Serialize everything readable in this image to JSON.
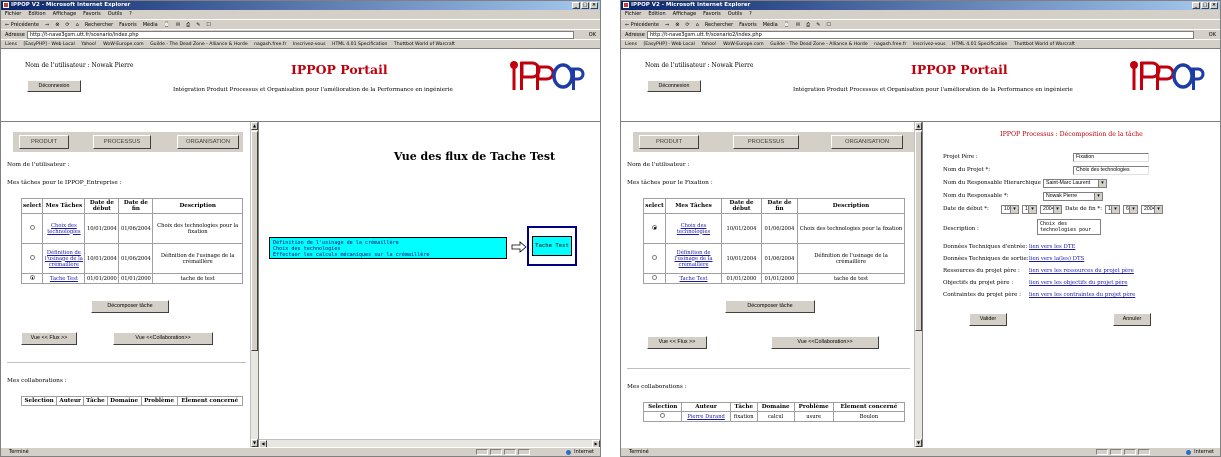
{
  "browser": {
    "window_title": "IPPOP V2 - Microsoft Internet Explorer",
    "menu": [
      "Fichier",
      "Edition",
      "Affichage",
      "Favoris",
      "Outils",
      "?"
    ],
    "toolbar": [
      "⇐ Précédente",
      "⇒",
      "⊗",
      "⟳",
      "⌂",
      "Rechercher",
      "Favoris",
      "Média",
      "⌚",
      "✉",
      "⎙",
      "✎",
      "☐"
    ],
    "address_label": "Adresse",
    "address_left": "http://t-nave3gsm.utt.fr/scenario/index.php",
    "address_right": "http://t-nave3gsm.utt.fr/scenario2/index.php",
    "go_label": "OK",
    "links_label": "Liens",
    "links": [
      "[EasyPHP] - Web Local",
      "Yahoo!",
      "WoW-Europe.com",
      "Guilde - The Dead Zone - Alliance & Horde",
      "nagash.free.fr",
      "Inscrivez-vous",
      "HTML 4.01 Specification",
      "Thottbot World of Warcraft"
    ],
    "status_text": "Terminé",
    "zone_text": "Internet"
  },
  "header": {
    "user_label_left": "Nom de l'utilisateur : Nowak Pierre",
    "user_label_right": "Nom de l'utilisateur : Nowak Pierre",
    "logout": "Déconnexion",
    "portal_title": "IPPOP Portail",
    "subtitle": "Intégration Produit Processus et Organisation pour l'amélioration de la Performance en ingénierie"
  },
  "tabs": [
    "PRODUIT",
    "PROCESSUS",
    "ORGANISATION"
  ],
  "left_panel": {
    "user_name_label": "Nom de l'utilisateur :",
    "tasks_title_left": "Mes tâches pour le IPPOP_Entreprise :",
    "tasks_title_right": "Mes tâches pour le Fixation :",
    "columns": [
      "select",
      "Mes Tâches",
      "Date de début",
      "Date de fin",
      "Description"
    ],
    "rows_left": [
      {
        "task": "Choix des technologies",
        "start": "10/01/2004",
        "end": "01/06/2004",
        "desc": "Choix des technologies pour la fixation",
        "selected": false
      },
      {
        "task": "Définition de l'usinage de la crémaillère",
        "start": "10/01/2004",
        "end": "01/06/2004",
        "desc": "Définition de l'usinage de la crémaillère",
        "selected": false
      },
      {
        "task": "Tache Test",
        "start": "01/01/2000",
        "end": "01/01/2000",
        "desc": "tache de test",
        "selected": true
      }
    ],
    "rows_right": [
      {
        "task": "Choix des technologies",
        "start": "10/01/2004",
        "end": "01/06/2004",
        "desc": "Choix des technologies pour la fixation",
        "selected": true
      },
      {
        "task": "Définition de l'usinage de la crémaillère",
        "start": "10/01/2004",
        "end": "01/06/2004",
        "desc": "Définition de l'usinage de la crémaillère",
        "selected": false
      },
      {
        "task": "Tache Test",
        "start": "01/01/2000",
        "end": "01/01/2000",
        "desc": "tache de test",
        "selected": false
      }
    ],
    "decompose": "Décomposer tâche",
    "view_flux": "Vue << Flux >>",
    "view_collab": "Vue <<Collaboration>>",
    "collab_title": "Mes collaborations :",
    "collab_columns": [
      "Selection",
      "Auteur",
      "Tâche",
      "Domaine",
      "Problème",
      "Element concerné"
    ],
    "collab_partial_row": [
      "",
      "Pierre Durand",
      "fixation",
      "calcul",
      "usure",
      "Boulon"
    ]
  },
  "flux_view": {
    "title": "Vue des flux de Tache Test",
    "inputs": [
      "Définition de l'usinage de la crémaillère",
      "Choix des technologies",
      "Effectuer les calculs mécaniques sur la crémaillère"
    ],
    "task": "Tache Test"
  },
  "decomp_form": {
    "title": "IPPOP Processus : Décomposition de la tâche",
    "parent_project_label": "Projet Père :",
    "parent_project": "Fixation",
    "project_name_label": "Nom du Projet *:",
    "project_name": "Choix des technologies",
    "hier_manager_label": "Nom du Responsable Hierarchique :",
    "hier_manager": "Saint-Marc Laurent",
    "manager_label": "Nom du Responsable *:",
    "manager": "Nowak Pierre",
    "start_label": "Date de début *:",
    "start_d": "10",
    "start_m": "1",
    "start_y": "2004",
    "end_label": "Date de fin *:",
    "end_d": "1",
    "end_m": "6",
    "end_y": "2004",
    "desc_label": "Description :",
    "desc_value": "Choix des\ntechnologies pour",
    "in_data_label": "Données Techniques d'entrée:",
    "in_data_link": "lien vers les DTE",
    "out_data_label": "Données Techniques de sortie:",
    "out_data_link": "lien vers la(les) DTS",
    "resources_label": "Ressources du projet père :",
    "resources_link": "lien vers les ressources du projet père",
    "objectives_label": "Objectifs du projet père :",
    "objectives_link": "lien vers les objectifs du projet père",
    "constraints_label": "Contraintes du projet père :",
    "constraints_link": "lien vers les contraintes du projet père",
    "validate": "Valider",
    "cancel": "Annuler"
  },
  "colors": {
    "portal_red": "#c0000c",
    "flux_cyan": "#00ffff",
    "title_bar": "#0a246a",
    "link": "#1a1aa6"
  }
}
